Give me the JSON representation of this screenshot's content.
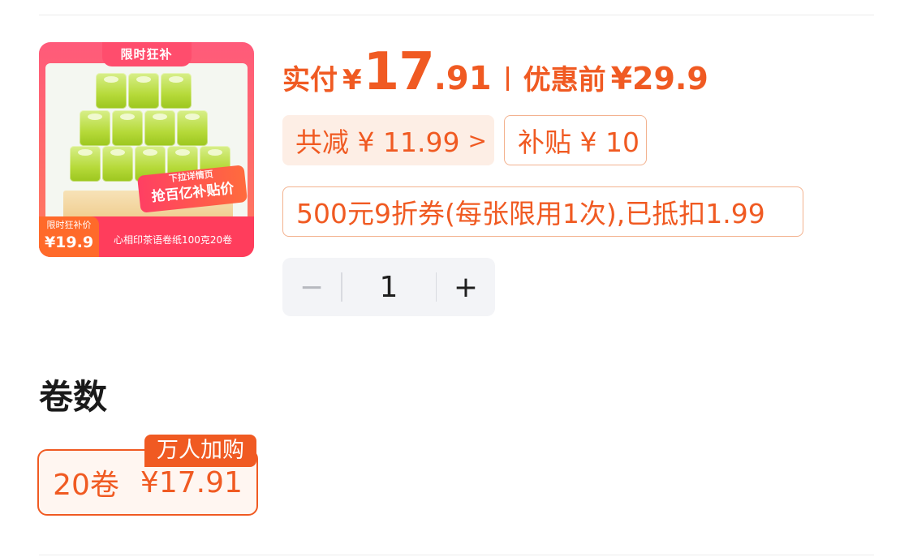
{
  "product": {
    "image": {
      "ribbon": "限时狂补",
      "promo_line1": "下拉详情页",
      "promo_line2": "抢百亿补贴价",
      "price_tag_label": "限时狂补价",
      "price_tag_value": "¥19.9",
      "caption": "心相印茶语卷纸100克20卷"
    }
  },
  "price": {
    "paid_label": "实付",
    "currency": "¥",
    "paid_integer": "17",
    "paid_decimal": ".91",
    "before_label": "优惠前",
    "before_value": "¥29.9"
  },
  "discounts": {
    "total_label": "共减 ¥ 11.99",
    "total_arrow": ">",
    "subsidy_label": "补贴 ¥ 10",
    "coupon_label": "500元9折券(每张限用1次),已抵扣1.99"
  },
  "quantity": {
    "minus": "−",
    "value": "1",
    "plus": "+"
  },
  "options": {
    "title": "卷数",
    "items": [
      {
        "name": "20卷",
        "price": "¥17.91",
        "badge": "万人加购",
        "selected": true
      }
    ]
  },
  "colors": {
    "accent": "#f05a22",
    "chip_bg": "#fdeee5",
    "stepper_bg": "#f3f4f7"
  }
}
